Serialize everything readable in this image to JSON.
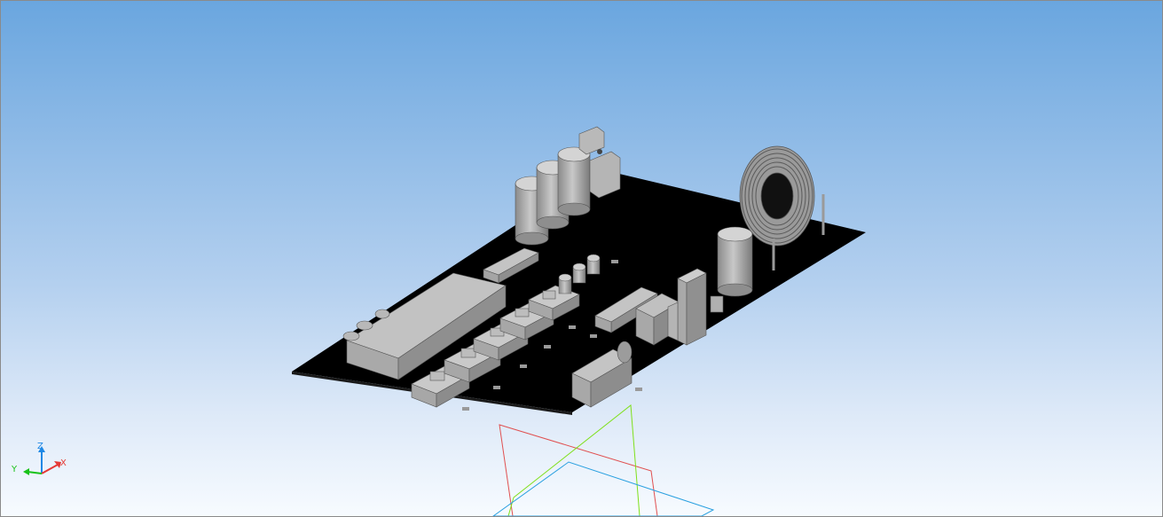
{
  "viewport": {
    "background_top": "#6aa6df",
    "background_bottom": "#f7fbff",
    "board_color": "#000000",
    "component_color": "#b0b0b0"
  },
  "triad": {
    "z_label": "Z",
    "y_label": "Y",
    "x_label": "X",
    "z_color": "#1e88e5",
    "y_color": "#19c219",
    "x_color": "#e53935"
  },
  "planes": {
    "xz_color": "#e05050",
    "yz_color": "#7ee01a",
    "xy_color": "#2aa0e0"
  }
}
